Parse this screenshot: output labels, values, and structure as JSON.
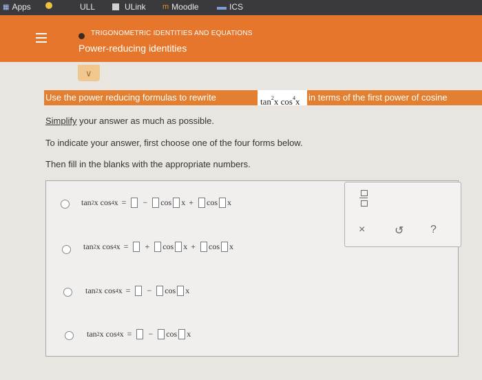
{
  "bookmarks": {
    "items": [
      {
        "label": "Apps",
        "icon": "apps-grid-icon"
      },
      {
        "label": "",
        "icon": "chrome-app-icon"
      },
      {
        "label": "ULL",
        "icon": "ull-icon"
      },
      {
        "label": "ULink",
        "icon": "ulink-icon"
      },
      {
        "label": "Moodle",
        "icon": "moodle-icon"
      },
      {
        "label": "ICS",
        "icon": "ics-icon"
      }
    ]
  },
  "header": {
    "topic": "TRIGONOMETRIC IDENTITIES AND EQUATIONS",
    "subtopic": "Power-reducing identities",
    "dropdown_icon": "chevron-down-icon",
    "colors": {
      "accent": "#e5762c",
      "dropdown": "#f0c88f"
    }
  },
  "prompt": {
    "before": "Use the power reducing formulas to rewrite",
    "expr": "tan²x cos⁴x",
    "after": "in terms of the first power of cosine"
  },
  "instructions": {
    "simplify_link": "Simplify",
    "simplify_rest": "your answer as much as possible.",
    "line2": "To indicate your answer, first choose one of the four forms below.",
    "line3": "Then fill in the blanks with the appropriate numbers."
  },
  "options": [
    {
      "lhs": "tan",
      "lhs2": "x cos",
      "rhs": "= □ − □cos□x + □cos□x"
    },
    {
      "lhs": "tan",
      "lhs2": "x cos",
      "rhs": "= □ + □cos□x + □cos□x"
    },
    {
      "lhs": "tan",
      "lhs2": "x cos",
      "rhs": "= □ − □cos□x"
    },
    {
      "lhs": "tan",
      "lhs2": "x cos",
      "rhs": "= □ − □cos□x"
    }
  ],
  "tools": {
    "fraction_icon": "fraction-icon",
    "clear_label": "×",
    "undo_label": "↺",
    "help_label": "?"
  }
}
